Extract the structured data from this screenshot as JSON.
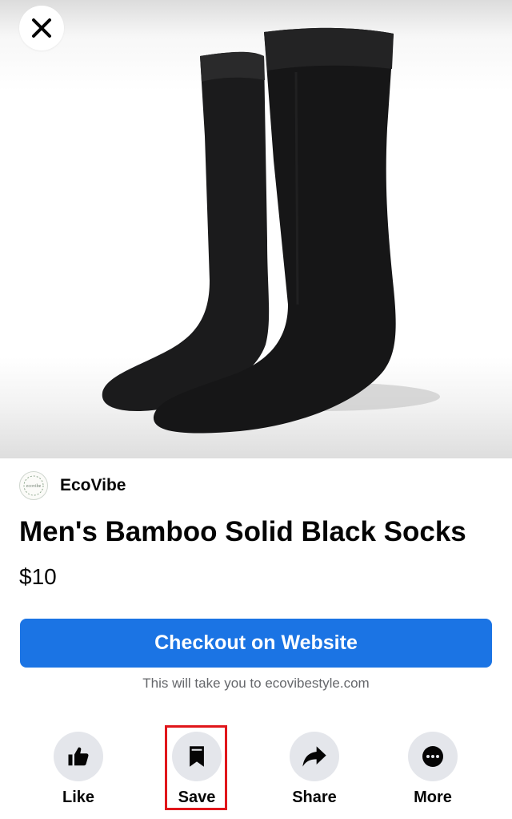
{
  "product_image": {
    "alt": "Black bamboo socks"
  },
  "header": {
    "close_icon": "close-icon"
  },
  "seller": {
    "name": "EcoVibe",
    "avatar_text": "ecovibe"
  },
  "product": {
    "title": "Men's Bamboo Solid Black Socks",
    "price": "$10"
  },
  "checkout": {
    "button_label": "Checkout on Website",
    "note": "This will take you to ecovibestyle.com"
  },
  "actions": [
    {
      "label": "Like",
      "icon": "thumbs-up-icon"
    },
    {
      "label": "Save",
      "icon": "bookmark-icon"
    },
    {
      "label": "Share",
      "icon": "share-arrow-icon"
    },
    {
      "label": "More",
      "icon": "more-dots-icon"
    }
  ],
  "colors": {
    "primary_blue": "#1b74e4",
    "highlight_red": "#e0161b",
    "action_circle": "#e4e6eb",
    "secondary_text": "#65676b"
  }
}
